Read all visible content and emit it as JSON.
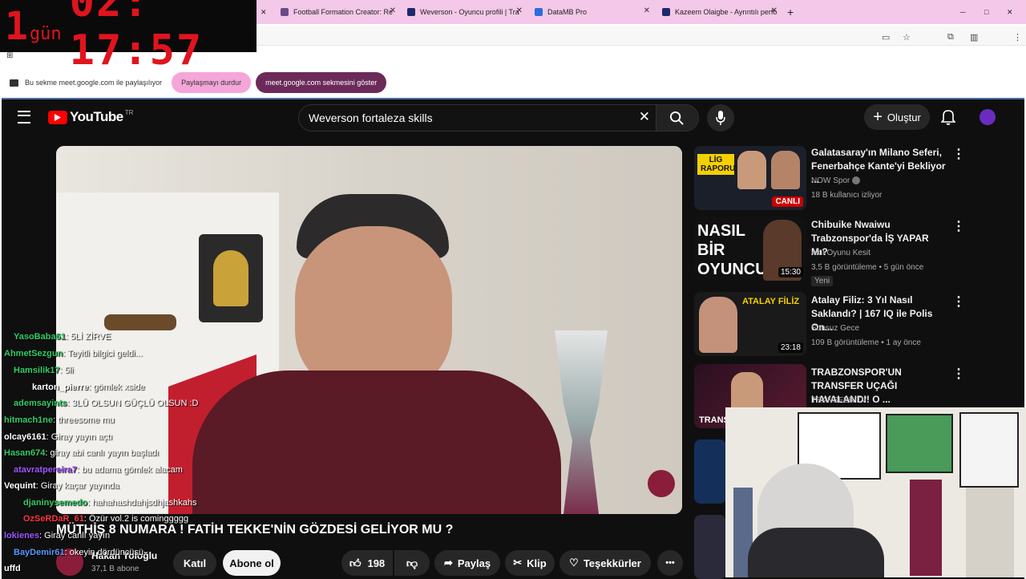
{
  "browser": {
    "tabs": [
      {
        "label": "Football Formation Creator: Re",
        "fav_color": "#6b4a8a"
      },
      {
        "label": "Weverson - Oyuncu profili | Tra",
        "fav_color": "#1e2a6b"
      },
      {
        "label": "DataMB Pro",
        "fav_color": "#2d6cdf"
      },
      {
        "label": "Kazeem Olaigbe - Ayrıntılı perfo",
        "fav_color": "#1e2a6b"
      }
    ],
    "new_tab": "+",
    "win_min": "─",
    "win_max": "□",
    "win_close": "✕",
    "share_text": "Bu sekme meet.google.com ile paylaşılıyor",
    "stop_share": "Paylaşmayı durdur",
    "show_tab": "meet.google.com sekmesini göster"
  },
  "countdown": {
    "day_num": "1",
    "day_word": "gün",
    "time": "02: 17:57"
  },
  "youtube": {
    "logo": "YouTube",
    "region": "TR",
    "search_query": "Weverson fortaleza skills",
    "create_label": "Oluştur",
    "video_title": "MÜTHİŞ 8 NUMARA ! FATİH TEKKE'NİN GÖZDESİ GELİYOR MU ?",
    "channel": "Hakan Yoloğlu",
    "subs": "37,1 B abone",
    "join": "Katıl",
    "subscribe": "Abone ol",
    "likes": "198",
    "share": "Paylaş",
    "clip": "Klip",
    "thanks": "Teşekkürler",
    "more": "•••"
  },
  "recommendations": [
    {
      "title": "Galatasaray'ın Milano Seferi, Fenerbahçe Kante'yi Bekliyor ...",
      "channel": "NOW Spor",
      "meta": "18 B kullanıcı izliyor",
      "badge": "CANLI",
      "thumb_text": "LİG RAPORU",
      "colors": [
        "#1b1f2a",
        "#c8102e"
      ]
    },
    {
      "title": "Chibuike Nwaiwu Trabzonspor'da İŞ YAPAR Mı?",
      "channel": "Akıl Oyunu Kesit",
      "meta": "3,5 B görüntüleme • 5 gün önce",
      "new": "Yeni",
      "duration": "15:30",
      "thumb_text": "NASIL BİR OYUNCU",
      "colors": [
        "#111",
        "#7a1f3d"
      ]
    },
    {
      "title": "Atalay Filiz: 3 Yıl Nasıl Saklandı? | 167 IQ ile Polis On...",
      "channel": "Sonsuz Gece",
      "meta": "109 B görüntüleme • 1 ay önce",
      "duration": "23:18",
      "thumb_text": "ATALAY FİLİZ",
      "colors": [
        "#1a1a1a",
        "#8a1d1d"
      ]
    },
    {
      "title": "TRABZONSPOR'UN TRANSFER UÇAĞI HAVALANDI! O ...",
      "channel": "TRANSFER TV",
      "meta": "",
      "thumb_text": "TRANSFER",
      "colors": [
        "#2a1020",
        "#5a1a30"
      ]
    }
  ],
  "chat": [
    {
      "user": "YasoBaba61",
      "msg": ": 5Lİ ZİRVE",
      "color": "#33cc66"
    },
    {
      "user": "AhmetSezgun",
      "msg": ": Teyitli bilgici geldi...",
      "color": "#33cc66"
    },
    {
      "user": "Hamsilik17",
      "msg": ": 5li",
      "color": "#33cc66"
    },
    {
      "user": "karton_pierre",
      "msg": ": gömlek xside",
      "color": "#ffffff"
    },
    {
      "user": "ademsayints",
      "msg": ": 3LÜ OLSUN GÜÇLÜ OLSUN :D",
      "color": "#33cc66"
    },
    {
      "user": "hitmach1ne",
      "msg": ": threesome mu",
      "color": "#33cc66"
    },
    {
      "user": "olcay6161",
      "msg": ": Giray yayın açtı",
      "color": "#ffffff"
    },
    {
      "user": "Hasan674",
      "msg": ": giray abi canlı yayın başladı",
      "color": "#33cc66"
    },
    {
      "user": "atavratpereira7",
      "msg": ": bu adama gömlek alacam",
      "color": "#a055ff"
    },
    {
      "user": "Vequint",
      "msg": ": Giray kaçar yayında",
      "color": "#ffffff"
    },
    {
      "user": "djaninysemedo",
      "msg": ": hahahashdahjsdhjashkahs",
      "color": "#33cc66"
    },
    {
      "user": "OzSeRDaR_61",
      "msg": ": Özür vol.2 is cominggggg",
      "color": "#ff3344"
    },
    {
      "user": "lokienes",
      "msg": ": Giray canlı yayın",
      "color": "#a055ff"
    },
    {
      "user": "BayDemir61",
      "msg": ": okeyin dördüncüsü",
      "color": "#5599ff"
    },
    {
      "user": "uffd",
      "msg": "",
      "color": "#ffffff"
    }
  ]
}
